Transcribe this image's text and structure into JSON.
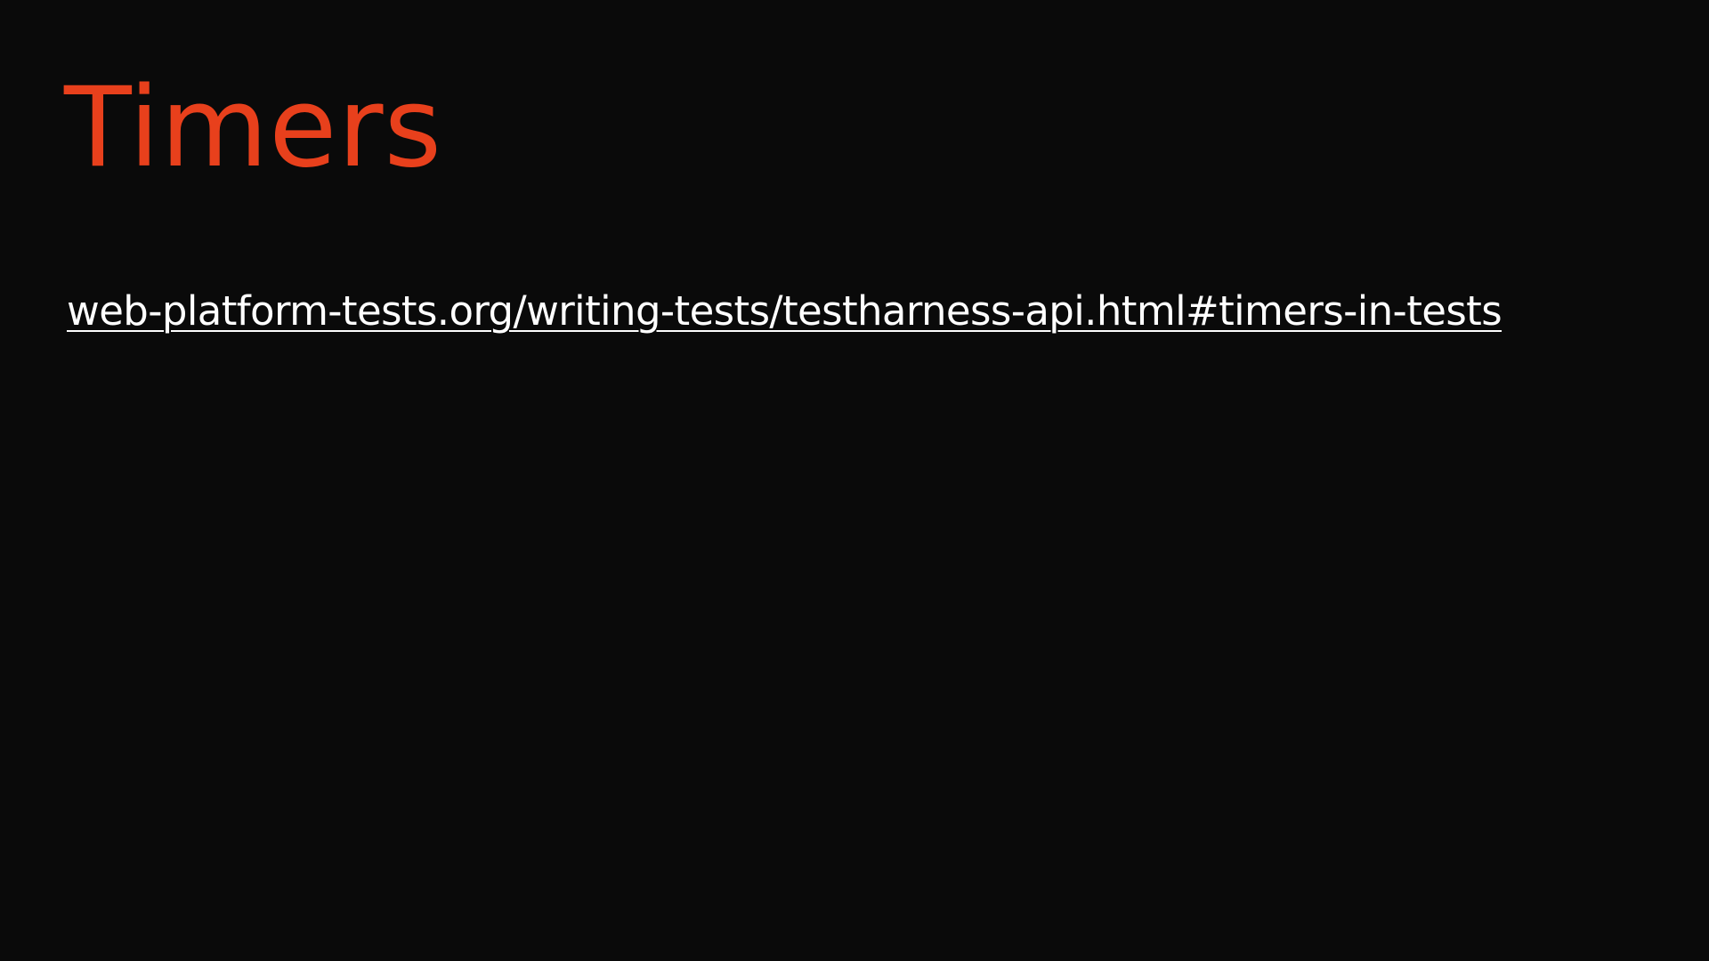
{
  "slide": {
    "title": "Timers",
    "link_text": "web-platform-tests.org/writing-tests/testharness-api.html#timers-in-tests"
  },
  "colors": {
    "background": "#0a0a0a",
    "title": "#e8401c",
    "link": "#ffffff"
  }
}
